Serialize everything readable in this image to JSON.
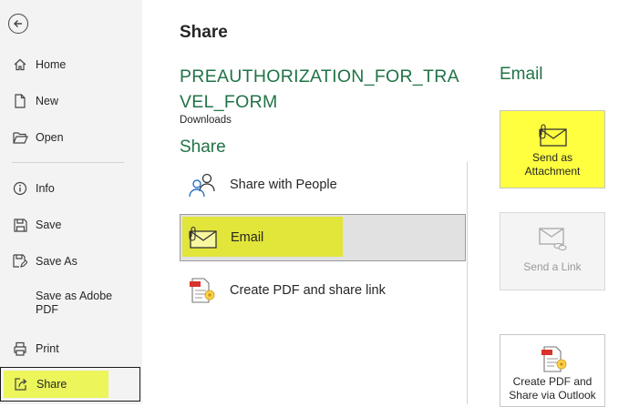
{
  "sidebar": {
    "items": [
      {
        "label": "Home",
        "icon": "home-icon"
      },
      {
        "label": "New",
        "icon": "new-document-icon"
      },
      {
        "label": "Open",
        "icon": "folder-open-icon"
      },
      {
        "label": "Info",
        "icon": "info-icon"
      },
      {
        "label": "Save",
        "icon": "save-icon"
      },
      {
        "label": "Save As",
        "icon": "save-as-icon"
      },
      {
        "label": "Save as Adobe PDF",
        "icon": ""
      },
      {
        "label": "Print",
        "icon": "print-icon"
      },
      {
        "label": "Share",
        "icon": "share-icon"
      }
    ],
    "selected": "Share"
  },
  "main": {
    "title": "Share",
    "filename": "PREAUTHORIZATION_FOR_TRAVEL_FORM",
    "location": "Downloads",
    "section_title": "Share",
    "options": [
      {
        "label": "Share with People",
        "icon": "share-people-icon"
      },
      {
        "label": "Email",
        "icon": "email-icon"
      },
      {
        "label": "Create PDF and share link",
        "icon": "create-pdf-icon"
      }
    ],
    "selected_option": "Email"
  },
  "email_panel": {
    "title": "Email",
    "buttons": [
      {
        "label": "Send as Attachment",
        "icon": "email-attachment-icon",
        "enabled": true
      },
      {
        "label": "Send a Link",
        "icon": "email-link-icon",
        "enabled": false
      },
      {
        "label": "Create PDF and Share via Outlook",
        "icon": "pdf-outlook-icon",
        "enabled": true
      }
    ]
  },
  "colors": {
    "accent_green": "#217346",
    "highlight_yellow": "#ffff40",
    "sidebar_bg": "#f3f3f3"
  }
}
